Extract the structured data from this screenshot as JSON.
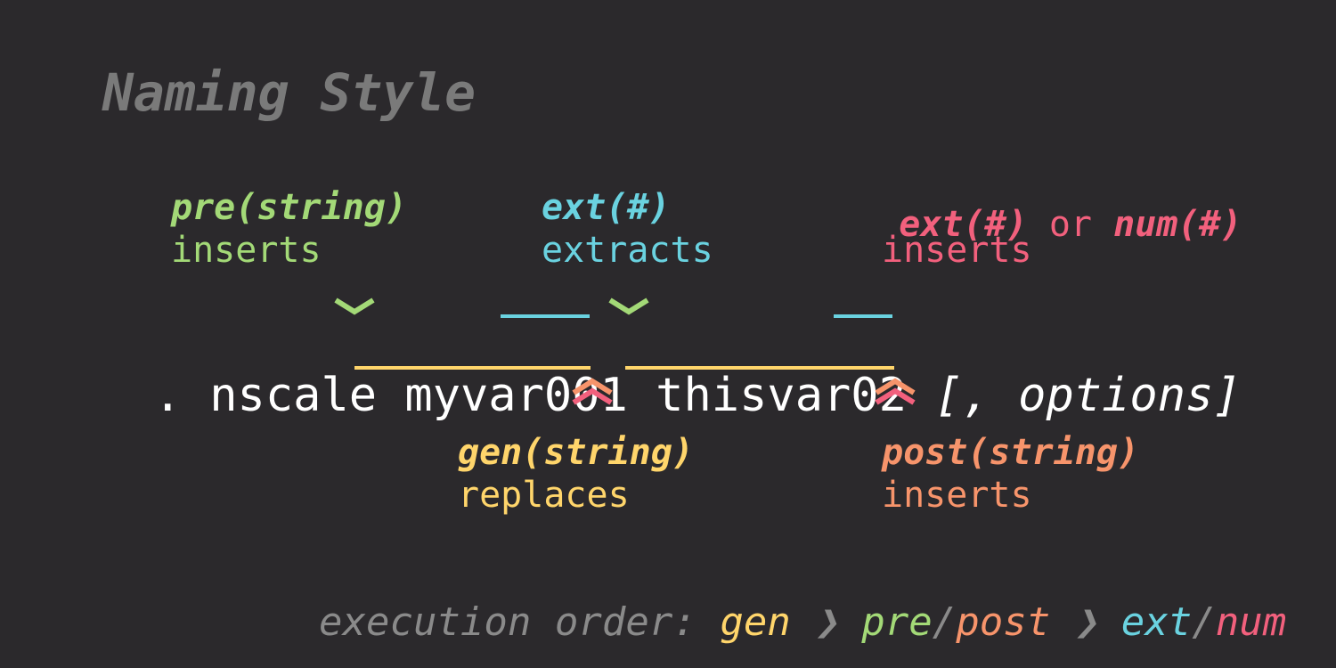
{
  "title": "Naming Style",
  "annotations": {
    "pre": {
      "option": "pre(string)",
      "action": "inserts"
    },
    "ext_extract": {
      "option": "ext(#)",
      "action": "extracts"
    },
    "ext_num": {
      "option1": "ext(#)",
      "connector": " or ",
      "option2": "num(#)",
      "action": "inserts"
    },
    "gen": {
      "option": "gen(string)",
      "action": "replaces"
    },
    "post": {
      "option": "post(string)",
      "action": "inserts"
    }
  },
  "command": {
    "prefix": ". nscale ",
    "var1": "myvar001",
    "var2": "thisvar02",
    "options": "[, options]"
  },
  "execution_order": {
    "label": "execution order: ",
    "gen": "gen",
    "sep1": " ❯ ",
    "pre": "pre",
    "slash1": "/",
    "post": "post",
    "sep2": " ❯ ",
    "ext": "ext",
    "slash2": "/",
    "num": "num"
  },
  "colors": {
    "background": "#2b292c",
    "title": "#7a7a7a",
    "pre": "#a3d977",
    "ext": "#6ad2e0",
    "num": "#f2607d",
    "gen": "#ffd56b",
    "post": "#f7946b"
  },
  "icons": [
    "chevron-down-icon",
    "double-chevron-up-icon"
  ]
}
